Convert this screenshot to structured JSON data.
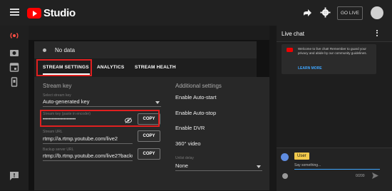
{
  "header": {
    "app_name": "Studio",
    "go_live_label": "GO LIVE"
  },
  "sidebar": {
    "icons": [
      "live-icon",
      "camera-icon",
      "calendar-icon",
      "phone-icon",
      "feedback-icon"
    ]
  },
  "stream": {
    "status_text": "No data"
  },
  "tabs": [
    {
      "label": "STREAM SETTINGS",
      "active": true
    },
    {
      "label": "ANALYTICS",
      "active": false
    },
    {
      "label": "STREAM HEALTH",
      "active": false
    }
  ],
  "stream_key": {
    "section_label": "Stream key",
    "select_label": "Select stream key",
    "selected_key": "Auto-generated key",
    "key_field_label": "Stream key (paste in encoder)",
    "key_value": "••••••••••••••••••••••",
    "copy_label": "COPY",
    "url_label": "Stream URL",
    "url_value": "rtmp://a.rtmp.youtube.com/live2",
    "backup_label": "Backup server URL",
    "backup_value": "rtmp://b.rtmp.youtube.com/live2?backu"
  },
  "additional": {
    "title": "Additional settings",
    "auto_start": "Enable Auto-start",
    "auto_stop": "Enable Auto-stop",
    "dvr": "Enable DVR",
    "video360": "360° video",
    "latency_label": "Unlist delay",
    "latency_value": "None"
  },
  "chat": {
    "title": "Live chat",
    "welcome_message": "Welcome to live chat! Remember to guard your privacy and abide by our community guidelines.",
    "learn_more": "LEARN MORE",
    "user_name": "User",
    "input_placeholder": "Say something...",
    "char_count": "0/200"
  },
  "colors": {
    "accent": "#3ea6ff",
    "brand": "#ff0000",
    "highlight": "#e02020",
    "user_badge": "#f2c94c"
  }
}
